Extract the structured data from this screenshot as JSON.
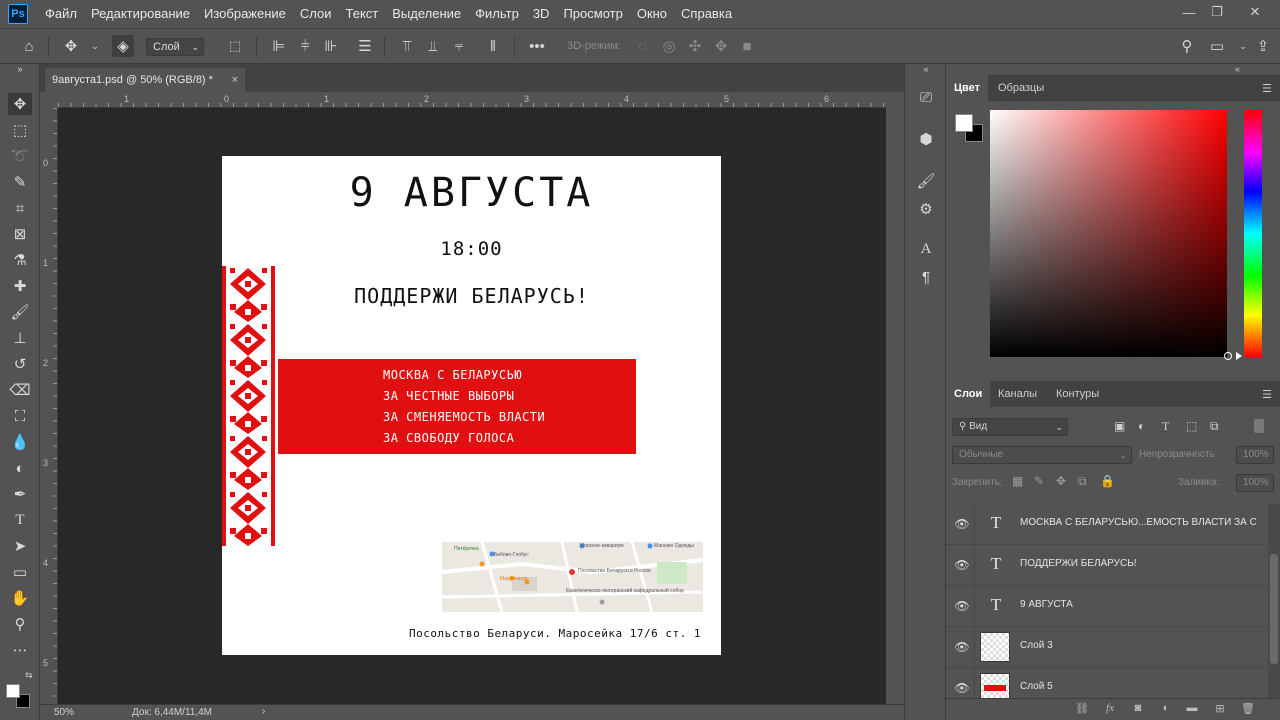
{
  "app": {
    "logo": "Ps",
    "menu": [
      "Файл",
      "Редактирование",
      "Изображение",
      "Слои",
      "Текст",
      "Выделение",
      "Фильтр",
      "3D",
      "Просмотр",
      "Окно",
      "Справка"
    ],
    "window_controls": {
      "minimize": "—",
      "restore": "❐",
      "close": "✕"
    }
  },
  "options_bar": {
    "layer_select": "Слой",
    "mode_3d_label": "3D-режим:"
  },
  "document": {
    "tab_title": "9августа1.psd @ 50% (RGB/8) *",
    "tab_close": "×",
    "ruler_top_labels": [
      "1",
      "0",
      "1",
      "2",
      "3",
      "4",
      "5",
      "6"
    ],
    "ruler_left_labels": [
      "0",
      "1",
      "2",
      "3",
      "4",
      "5"
    ],
    "zoom": "50%",
    "doc_info": "Док: 6,44M/11,4M"
  },
  "canvas": {
    "title": "9 АВГУСТА",
    "time": "18:00",
    "support": "ПОДДЕРЖИ БЕЛАРУСЬ!",
    "red_lines": [
      "МОСКВА С БЕЛАРУСЬЮ",
      "ЗА ЧЕСТНЫЕ ВЫБОРЫ",
      "ЗА СМЕНЯЕМОСТЬ ВЛАСТИ",
      "ЗА СВОБОДУ ГОЛОСА"
    ],
    "address": "Посольство Беларуси. Маросейка 17/6 ст. 1",
    "map_labels": {
      "l1": "Морское-аквариум",
      "l2": "Магазин Одежды",
      "l3": "Библио-Глобус",
      "l4": "Посольство Беларуси в России",
      "l5": "Евангелическо-лютеранский кафедральный собор",
      "l6": "Пятёрочка",
      "l7": "Макдоналдс"
    }
  },
  "colors": {
    "accent_red": "#e01010",
    "app_bg": "#535353",
    "pasteboard": "#282828"
  },
  "right_panel": {
    "color_tabs": [
      "Цвет",
      "Образцы"
    ],
    "layers_tabs": [
      "Слои",
      "Каналы",
      "Контуры"
    ],
    "filter_label": "Вид",
    "blend_mode": "Обычные",
    "opacity_label": "Непрозрачность:",
    "opacity_value": "100%",
    "lock_label": "Закрепить:",
    "fill_label": "Заливка:",
    "fill_value": "100%",
    "layers": [
      {
        "name": "МОСКВА С БЕЛАРУСЬЮ...ЕМОСТЬ ВЛАСТИ ЗА С",
        "type": "text"
      },
      {
        "name": "ПОДДЕРЖИ БЕЛАРУСЬ!",
        "type": "text"
      },
      {
        "name": "9 АВГУСТА",
        "type": "text"
      },
      {
        "name": "Слой 3",
        "type": "pixel"
      },
      {
        "name": "Слой 5",
        "type": "pixel-red"
      }
    ]
  }
}
